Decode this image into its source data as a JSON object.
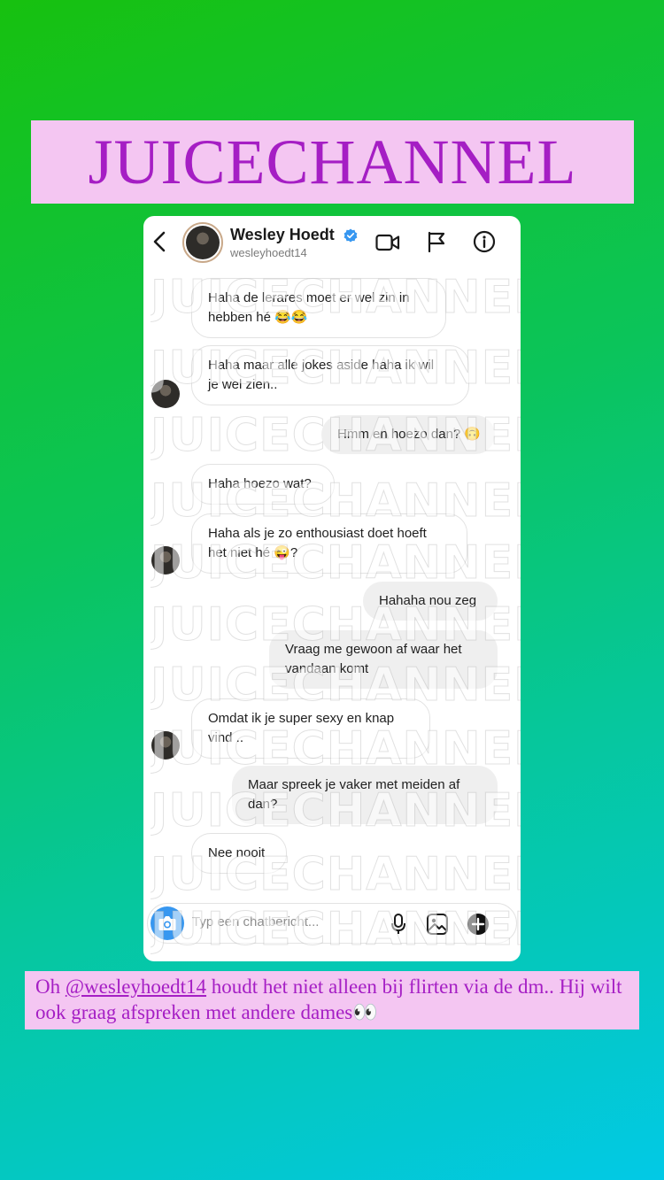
{
  "brand": {
    "title": "JUICECHANNEL"
  },
  "header": {
    "name": "Wesley Hoedt",
    "handle": "wesleyhoedt14"
  },
  "watermark_text": "JUICECHANNEL",
  "messages": [
    {
      "side": "in",
      "lines": [
        "Haha de lerares moet er wel zin in",
        "hebben hé 😂😂"
      ]
    },
    {
      "side": "in",
      "lines": [
        "Haha maar alle jokes aside haha ik wil",
        "je wel zien.."
      ]
    },
    {
      "side": "out",
      "lines": [
        "Hmm en hoezo dan? 🙃"
      ]
    },
    {
      "side": "in",
      "lines": [
        "Haha hoezo wat?"
      ]
    },
    {
      "side": "in",
      "lines": [
        "Haha als je zo enthousiast doet hoeft",
        "het niet hé 😜?"
      ]
    },
    {
      "side": "out",
      "lines": [
        "Hahaha nou zeg"
      ]
    },
    {
      "side": "out",
      "lines": [
        "Vraag me gewoon af waar het",
        "vandaan komt"
      ]
    },
    {
      "side": "in",
      "lines": [
        "Omdat ik je super sexy en knap",
        "vind .."
      ]
    },
    {
      "side": "out",
      "lines": [
        "Maar spreek je vaker met meiden af",
        "dan?"
      ]
    },
    {
      "side": "in",
      "lines": [
        "Nee nooit"
      ]
    }
  ],
  "composer": {
    "placeholder": "Typ een chatbericht..."
  },
  "caption": {
    "prefix": "Oh ",
    "mention": "@wesleyhoedt14",
    "rest": " houdt het niet alleen bij flirten via de dm.. Hij wilt ook graag afspreken met andere dames👀"
  },
  "colors": {
    "banner_bg": "#f4c6f2",
    "banner_text": "#a51ec4",
    "verified": "#3797f0",
    "camera_button": "#3797f0",
    "outgoing_bubble": "#efefef"
  },
  "icons": [
    "back-arrow-icon",
    "verified-badge-icon",
    "video-call-icon",
    "flag-icon",
    "info-icon",
    "camera-icon",
    "microphone-icon",
    "gallery-icon",
    "plus-icon"
  ]
}
